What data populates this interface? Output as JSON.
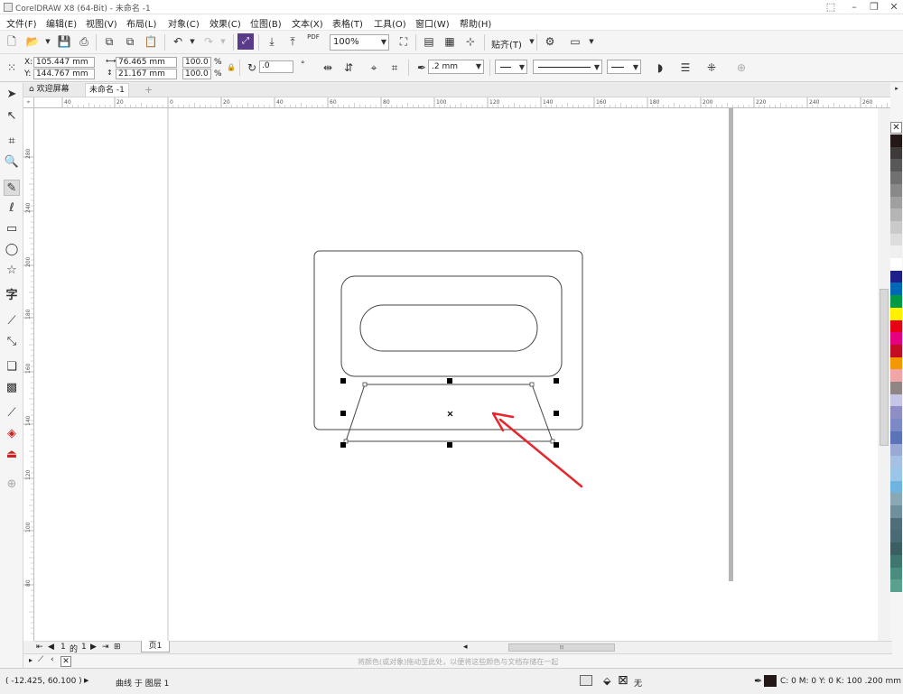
{
  "window": {
    "title": "CorelDRAW X8 (64-Bit) - 未命名 -1"
  },
  "menu": [
    "文件(F)",
    "编辑(E)",
    "视图(V)",
    "布局(L)",
    "对象(C)",
    "效果(C)",
    "位图(B)",
    "文本(X)",
    "表格(T)",
    "工具(O)",
    "窗口(W)",
    "帮助(H)"
  ],
  "toolbar": {
    "zoom_value": "100%",
    "snap_label": "贴齐(T)",
    "pdf_label": "PDF"
  },
  "property_bar": {
    "x_label": "X:",
    "x_value": "105.447 mm",
    "y_label": "Y:",
    "y_value": "144.767 mm",
    "width_value": "76.465 mm",
    "height_value": "21.167 mm",
    "scale_x": "100.0",
    "scale_y": "100.0",
    "percent": "%",
    "rotation": ".0",
    "outline_width": ".2 mm"
  },
  "tabs": {
    "welcome": "欢迎屏幕",
    "document": "未命名 -1"
  },
  "ruler": {
    "h_ticks": [
      "40",
      "20",
      "0",
      "20",
      "40",
      "60",
      "80",
      "100",
      "120",
      "140",
      "160",
      "180",
      "200",
      "220",
      "240",
      "260"
    ],
    "v_ticks": [
      "280",
      "240",
      "200",
      "180",
      "160",
      "140",
      "120",
      "100",
      "80"
    ],
    "unit": "毫米"
  },
  "page_nav": {
    "current": "1",
    "of_label": "的",
    "total": "1",
    "page_tab": "页1"
  },
  "doc_palette_hint": "将颜色(或对象)拖动至此处，以便将这些颜色与文档存储在一起",
  "status": {
    "coords": "( -12.425, 60.100 )",
    "object_info": "曲线 于 图层 1",
    "fill_label": "无",
    "outline_info": "C: 0 M: 0 Y: 0 K: 100  .200 mm"
  },
  "palette_colors": [
    "#231815",
    "#3e3a39",
    "#595757",
    "#727171",
    "#898989",
    "#9fa0a0",
    "#b5b5b6",
    "#c9caca",
    "#dcdddd",
    "#efefef",
    "#ffffff",
    "#1d2088",
    "#0068b7",
    "#009944",
    "#fff100",
    "#e60012",
    "#e4007f",
    "#c30d23",
    "#f39800",
    "#f0a6a6",
    "#8f8585",
    "#c7c5e6",
    "#8e8ec4",
    "#7b8ac6",
    "#5b74b8",
    "#9aa9d6",
    "#a6c1e4",
    "#9ac7e8",
    "#6fb4e0",
    "#8aa8b4",
    "#6e8f9b",
    "#506e7a",
    "#4a6b75",
    "#3b5e62",
    "#3e7670",
    "#4a8c7e",
    "#5aa08e"
  ],
  "colors": {
    "arrow": "#e8252c",
    "selection": "#000000",
    "canvas_bg": "#ffffff",
    "page_shadow": "#b5b5b5"
  }
}
